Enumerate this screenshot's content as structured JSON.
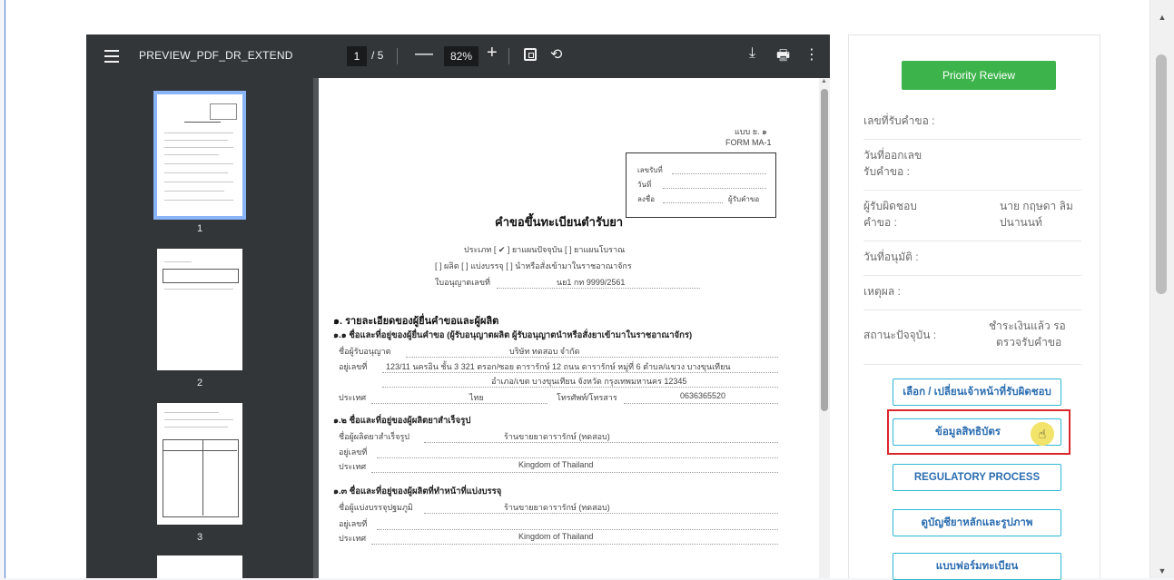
{
  "viewer": {
    "title": "PREVIEW_PDF_DR_EXTEND",
    "page_current": "1",
    "page_total": "/ 5",
    "zoom": "82%",
    "zoom_minus": "—",
    "zoom_plus": "+",
    "thumbnails": [
      {
        "label": "1",
        "selected": true
      },
      {
        "label": "2",
        "selected": false
      },
      {
        "label": "3",
        "selected": false
      }
    ]
  },
  "document": {
    "form_code_th": "แบบ ย. ๑",
    "form_code_en": "FORM MA-1",
    "receipt": {
      "no_label": "เลขรับที่",
      "date_label": "วันที่",
      "sign_label": "ลงชื่อ",
      "receiver_label": "ผู้รับคำขอ"
    },
    "title": "คำขอขึ้นทะเบียนตำรับยา",
    "type_line": "ประเภท [ ✔ ] ยาแผนปัจจุบัน [ ] ยาแผนโบราณ",
    "kind_line": "[ ] ผลิต [ ] แบ่งบรรจุ [ ] นำหรือสั่งเข้ามาในราชอาณาจักร",
    "license_label": "ใบอนุญาตเลขที่",
    "license_value": "นย1 กท 9999/2561",
    "sec1_title": "๑. รายละเอียดของผู้ยื่นคำขอและผู้ผลิต",
    "sec11_title": "๑.๑ ชื่อและที่อยู่ของผู้ยื่นคำขอ (ผู้รับอนุญาตผลิต ผู้รับอนุญาตนำหรือสั่งยาเข้ามาในราชอาณาจักร)",
    "licensee_label": "ชื่อผู้รับอนุญาต",
    "licensee_value": "บริษัท ทดสอบ จำกัด",
    "address_label": "อยู่เลขที่",
    "address_value1": "123/11 นครอิน ชั้น 3 321 ตรอก/ซอย ดารารักษ์ 12 ถนน ดารารักษ์ หมู่ที่ 6 ตำบล/แขวง บางขุนเทียน",
    "address_value2": "อำเภอ/เขต บางขุนเทียน จังหวัด กรุงเทพมหานคร 12345",
    "country_label": "ประเทศ",
    "country_value_th": "ไทย",
    "phone_label": "โทรศัพท์/โทรสาร",
    "phone_value": "0636365520",
    "sec12_title": "๑.๒ ชื่อและที่อยู่ของผู้ผลิตยาสำเร็จรูป",
    "maker_label": "ชื่อผู้ผลิตยาสำเร็จรูป",
    "maker_value": "ร้านขายยาดารารักษ์ (ทดสอบ)",
    "addr2_label": "อยู่เลขที่",
    "country2_label": "ประเทศ",
    "country2_value": "Kingdom of Thailand",
    "sec13_title": "๑.๓ ชื่อและที่อยู่ของผู้ผลิตที่ทำหน้าที่แบ่งบรรจุ",
    "packer_label": "ชื่อผู้แบ่งบรรจุปฐมภูมิ",
    "packer_value": "ร้านขายยาดารารักษ์ (ทดสอบ)",
    "addr3_label": "อยู่เลขที่",
    "country3_label": "ประเทศ",
    "country3_value": "Kingdom of Thailand"
  },
  "panel": {
    "priority_button": "Priority Review",
    "rows": [
      {
        "label": "เลขที่รับคำขอ :",
        "value": ""
      },
      {
        "label": "วันที่ออกเลข",
        "label2": "รับคำขอ :",
        "value": ""
      },
      {
        "label": "ผู้รับผิดชอบ",
        "label2": "คำขอ :",
        "value": "นาย กฤษดา ลิม",
        "value2": "ปนานนท์"
      },
      {
        "label": "วันที่อนุมัติ :",
        "value": ""
      },
      {
        "label": "เหตุผล :",
        "value": ""
      },
      {
        "label": "สถานะปัจจุบัน :",
        "value": "ชำระเงินแล้ว รอ",
        "value2": "ตรวจรับคำขอ"
      }
    ],
    "buttons": [
      "เลือก / เปลี่ยนเจ้าหน้าที่รับผิดชอบ",
      "ข้อมูลสิทธิบัตร",
      "REGULATORY PROCESS",
      "ดูบัญชียาหลักและรูปภาพ",
      "แบบฟอร์มทะเบียน"
    ]
  },
  "colors": {
    "priority_green": "#3cb44b",
    "button_border": "#2fb8d6",
    "highlight_red": "#d9262c",
    "viewer_toolbar": "#323639"
  }
}
